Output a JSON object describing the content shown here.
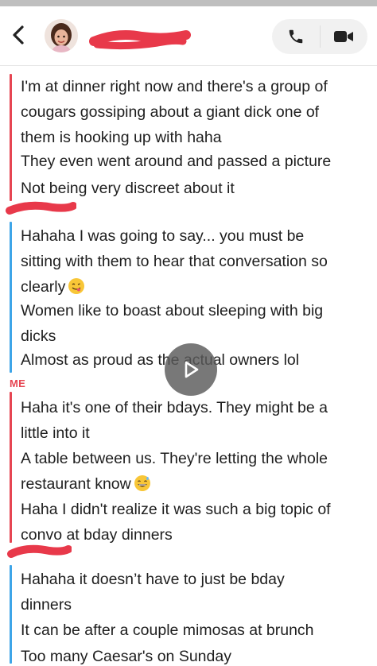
{
  "header": {
    "back_icon": "chevron-left-icon",
    "phone_icon": "phone-icon",
    "video_icon": "video-camera-icon"
  },
  "colors": {
    "me": "#e64552",
    "them": "#3ea5e8",
    "redaction": "#e8394a"
  },
  "chat": {
    "me_label": "ME",
    "groups": [
      {
        "sender": "me",
        "messages": [
          [
            "I'm at dinner right now and there's a group of",
            "cougars gossiping about a giant dick one of",
            "them is hooking up with haha"
          ],
          [
            "They even went around and passed a picture"
          ],
          [
            "Not being very discreet about it"
          ]
        ]
      },
      {
        "sender": "them",
        "messages": [
          [
            "Hahaha I was going to say... you must be",
            "sitting with them to hear that conversation so",
            "clearly"
          ],
          [
            "Women like to boast about sleeping with big",
            "dicks"
          ],
          [
            "Almost as proud as the actual owners lol"
          ]
        ]
      },
      {
        "sender": "me",
        "messages": [
          [
            "Haha it's one of their bdays. They might be a",
            "little into it"
          ],
          [
            "A table between us. They're letting the whole",
            "restaurant know"
          ],
          [
            "Haha I didn't realize it was such a big topic of",
            "convo at bday dinners"
          ]
        ]
      },
      {
        "sender": "them",
        "messages": [
          [
            "Hahaha it doesn’t have to just be bday",
            "dinners"
          ],
          [
            "It can be after a couple mimosas at brunch"
          ],
          [
            "Too many Caesar's on Sunday"
          ]
        ]
      }
    ]
  }
}
